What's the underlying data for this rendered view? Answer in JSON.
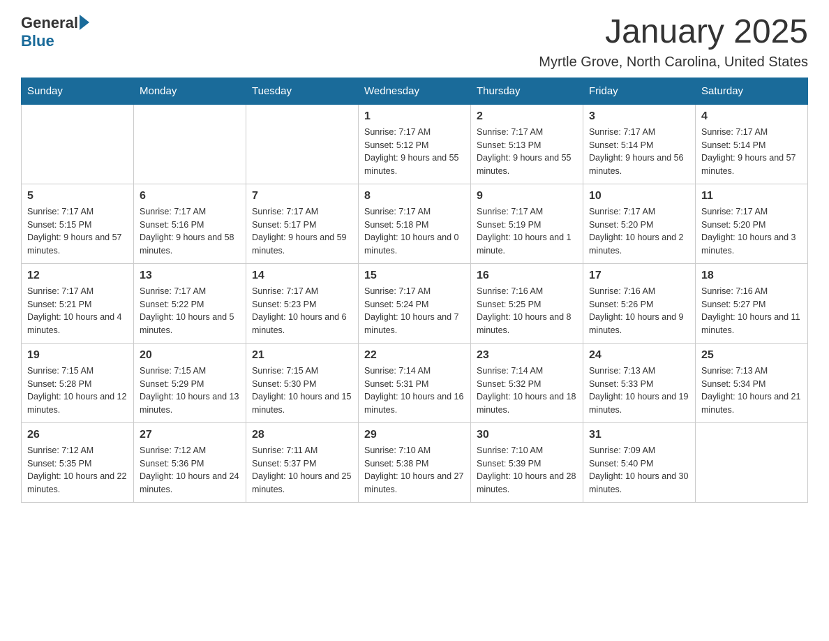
{
  "header": {
    "logo_general": "General",
    "logo_blue": "Blue",
    "month_title": "January 2025",
    "location": "Myrtle Grove, North Carolina, United States"
  },
  "days_of_week": [
    "Sunday",
    "Monday",
    "Tuesday",
    "Wednesday",
    "Thursday",
    "Friday",
    "Saturday"
  ],
  "weeks": [
    [
      {
        "day": "",
        "sunrise": "",
        "sunset": "",
        "daylight": ""
      },
      {
        "day": "",
        "sunrise": "",
        "sunset": "",
        "daylight": ""
      },
      {
        "day": "",
        "sunrise": "",
        "sunset": "",
        "daylight": ""
      },
      {
        "day": "1",
        "sunrise": "Sunrise: 7:17 AM",
        "sunset": "Sunset: 5:12 PM",
        "daylight": "Daylight: 9 hours and 55 minutes."
      },
      {
        "day": "2",
        "sunrise": "Sunrise: 7:17 AM",
        "sunset": "Sunset: 5:13 PM",
        "daylight": "Daylight: 9 hours and 55 minutes."
      },
      {
        "day": "3",
        "sunrise": "Sunrise: 7:17 AM",
        "sunset": "Sunset: 5:14 PM",
        "daylight": "Daylight: 9 hours and 56 minutes."
      },
      {
        "day": "4",
        "sunrise": "Sunrise: 7:17 AM",
        "sunset": "Sunset: 5:14 PM",
        "daylight": "Daylight: 9 hours and 57 minutes."
      }
    ],
    [
      {
        "day": "5",
        "sunrise": "Sunrise: 7:17 AM",
        "sunset": "Sunset: 5:15 PM",
        "daylight": "Daylight: 9 hours and 57 minutes."
      },
      {
        "day": "6",
        "sunrise": "Sunrise: 7:17 AM",
        "sunset": "Sunset: 5:16 PM",
        "daylight": "Daylight: 9 hours and 58 minutes."
      },
      {
        "day": "7",
        "sunrise": "Sunrise: 7:17 AM",
        "sunset": "Sunset: 5:17 PM",
        "daylight": "Daylight: 9 hours and 59 minutes."
      },
      {
        "day": "8",
        "sunrise": "Sunrise: 7:17 AM",
        "sunset": "Sunset: 5:18 PM",
        "daylight": "Daylight: 10 hours and 0 minutes."
      },
      {
        "day": "9",
        "sunrise": "Sunrise: 7:17 AM",
        "sunset": "Sunset: 5:19 PM",
        "daylight": "Daylight: 10 hours and 1 minute."
      },
      {
        "day": "10",
        "sunrise": "Sunrise: 7:17 AM",
        "sunset": "Sunset: 5:20 PM",
        "daylight": "Daylight: 10 hours and 2 minutes."
      },
      {
        "day": "11",
        "sunrise": "Sunrise: 7:17 AM",
        "sunset": "Sunset: 5:20 PM",
        "daylight": "Daylight: 10 hours and 3 minutes."
      }
    ],
    [
      {
        "day": "12",
        "sunrise": "Sunrise: 7:17 AM",
        "sunset": "Sunset: 5:21 PM",
        "daylight": "Daylight: 10 hours and 4 minutes."
      },
      {
        "day": "13",
        "sunrise": "Sunrise: 7:17 AM",
        "sunset": "Sunset: 5:22 PM",
        "daylight": "Daylight: 10 hours and 5 minutes."
      },
      {
        "day": "14",
        "sunrise": "Sunrise: 7:17 AM",
        "sunset": "Sunset: 5:23 PM",
        "daylight": "Daylight: 10 hours and 6 minutes."
      },
      {
        "day": "15",
        "sunrise": "Sunrise: 7:17 AM",
        "sunset": "Sunset: 5:24 PM",
        "daylight": "Daylight: 10 hours and 7 minutes."
      },
      {
        "day": "16",
        "sunrise": "Sunrise: 7:16 AM",
        "sunset": "Sunset: 5:25 PM",
        "daylight": "Daylight: 10 hours and 8 minutes."
      },
      {
        "day": "17",
        "sunrise": "Sunrise: 7:16 AM",
        "sunset": "Sunset: 5:26 PM",
        "daylight": "Daylight: 10 hours and 9 minutes."
      },
      {
        "day": "18",
        "sunrise": "Sunrise: 7:16 AM",
        "sunset": "Sunset: 5:27 PM",
        "daylight": "Daylight: 10 hours and 11 minutes."
      }
    ],
    [
      {
        "day": "19",
        "sunrise": "Sunrise: 7:15 AM",
        "sunset": "Sunset: 5:28 PM",
        "daylight": "Daylight: 10 hours and 12 minutes."
      },
      {
        "day": "20",
        "sunrise": "Sunrise: 7:15 AM",
        "sunset": "Sunset: 5:29 PM",
        "daylight": "Daylight: 10 hours and 13 minutes."
      },
      {
        "day": "21",
        "sunrise": "Sunrise: 7:15 AM",
        "sunset": "Sunset: 5:30 PM",
        "daylight": "Daylight: 10 hours and 15 minutes."
      },
      {
        "day": "22",
        "sunrise": "Sunrise: 7:14 AM",
        "sunset": "Sunset: 5:31 PM",
        "daylight": "Daylight: 10 hours and 16 minutes."
      },
      {
        "day": "23",
        "sunrise": "Sunrise: 7:14 AM",
        "sunset": "Sunset: 5:32 PM",
        "daylight": "Daylight: 10 hours and 18 minutes."
      },
      {
        "day": "24",
        "sunrise": "Sunrise: 7:13 AM",
        "sunset": "Sunset: 5:33 PM",
        "daylight": "Daylight: 10 hours and 19 minutes."
      },
      {
        "day": "25",
        "sunrise": "Sunrise: 7:13 AM",
        "sunset": "Sunset: 5:34 PM",
        "daylight": "Daylight: 10 hours and 21 minutes."
      }
    ],
    [
      {
        "day": "26",
        "sunrise": "Sunrise: 7:12 AM",
        "sunset": "Sunset: 5:35 PM",
        "daylight": "Daylight: 10 hours and 22 minutes."
      },
      {
        "day": "27",
        "sunrise": "Sunrise: 7:12 AM",
        "sunset": "Sunset: 5:36 PM",
        "daylight": "Daylight: 10 hours and 24 minutes."
      },
      {
        "day": "28",
        "sunrise": "Sunrise: 7:11 AM",
        "sunset": "Sunset: 5:37 PM",
        "daylight": "Daylight: 10 hours and 25 minutes."
      },
      {
        "day": "29",
        "sunrise": "Sunrise: 7:10 AM",
        "sunset": "Sunset: 5:38 PM",
        "daylight": "Daylight: 10 hours and 27 minutes."
      },
      {
        "day": "30",
        "sunrise": "Sunrise: 7:10 AM",
        "sunset": "Sunset: 5:39 PM",
        "daylight": "Daylight: 10 hours and 28 minutes."
      },
      {
        "day": "31",
        "sunrise": "Sunrise: 7:09 AM",
        "sunset": "Sunset: 5:40 PM",
        "daylight": "Daylight: 10 hours and 30 minutes."
      },
      {
        "day": "",
        "sunrise": "",
        "sunset": "",
        "daylight": ""
      }
    ]
  ]
}
